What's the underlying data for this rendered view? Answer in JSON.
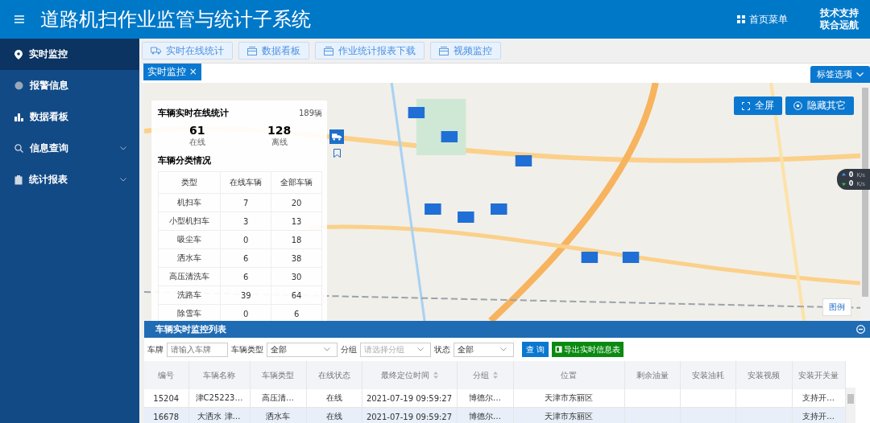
{
  "header": {
    "title": "道路机扫作业监管与统计子系统",
    "menu_label": "首页菜单",
    "support_line1": "技术支持",
    "support_line2": "联合远航"
  },
  "sidebar": {
    "items": [
      {
        "label": "实时监控",
        "kind": "link",
        "selected": true
      },
      {
        "label": "报警信息",
        "kind": "link",
        "selected": false
      },
      {
        "label": "数据看板",
        "kind": "link",
        "selected": false
      },
      {
        "label": "信息查询",
        "kind": "group",
        "selected": false
      },
      {
        "label": "统计报表",
        "kind": "group",
        "selected": false
      }
    ]
  },
  "toolbar": [
    {
      "label": "实时在线统计"
    },
    {
      "label": "数据看板"
    },
    {
      "label": "作业统计报表下载"
    },
    {
      "label": "视频监控"
    }
  ],
  "tags": [
    {
      "label": "实时监控",
      "close": "×",
      "selected": true
    }
  ],
  "tag_options": "标签选项",
  "map": {
    "fullscreen": "全屏",
    "hide_others": "隐藏其它",
    "legend": "图例"
  },
  "stats": {
    "title": "车辆实时在线统计",
    "total": "189辆",
    "online_count": "61",
    "online_label": "在线",
    "offline_count": "128",
    "offline_label": "离线",
    "category_title": "车辆分类情况",
    "columns": [
      "类型",
      "在线车辆",
      "全部车辆"
    ],
    "rows": [
      [
        "机扫车",
        "7",
        "20"
      ],
      [
        "小型机扫车",
        "3",
        "13"
      ],
      [
        "吸尘车",
        "0",
        "18"
      ],
      [
        "洒水车",
        "6",
        "38"
      ],
      [
        "高压清洗车",
        "6",
        "30"
      ],
      [
        "洗路车",
        "39",
        "64"
      ],
      [
        "除雪车",
        "0",
        "6"
      ]
    ]
  },
  "net_speed": {
    "up": "0",
    "up_unit": "K/s",
    "down": "0",
    "down_unit": "K/s"
  },
  "list": {
    "title": "车辆实时监控列表",
    "filters": {
      "plate_label": "车牌",
      "plate_placeholder": "请输入车牌",
      "type_label": "车辆类型",
      "type_value": "全部",
      "group_label": "分组",
      "group_placeholder": "请选择分组",
      "status_label": "状态",
      "status_value": "全部"
    },
    "query_button": "查 询",
    "export_button": "导出实时信息表",
    "columns": [
      {
        "label": "编号",
        "sortable": false
      },
      {
        "label": "车辆名称",
        "sortable": false
      },
      {
        "label": "车辆类型",
        "sortable": false
      },
      {
        "label": "在线状态",
        "sortable": false
      },
      {
        "label": "最终定位时间",
        "sortable": true
      },
      {
        "label": "分组",
        "sortable": true
      },
      {
        "label": "位置",
        "sortable": false
      },
      {
        "label": "剩余油量",
        "sortable": false
      },
      {
        "label": "安装油耗",
        "sortable": false
      },
      {
        "label": "安装视频",
        "sortable": false
      },
      {
        "label": "安装开关量",
        "sortable": false
      }
    ],
    "rows": [
      {
        "selected": false,
        "cells": [
          "15204",
          "津C25223…",
          "高压清…",
          "在线",
          "2021-07-19 09:59:27",
          "博德尔…",
          "天津市东丽区",
          "",
          "",
          "",
          "支持开…"
        ]
      },
      {
        "selected": true,
        "cells": [
          "16678",
          "大洒水 津…",
          "洒水车",
          "在线",
          "2021-07-19 09:59:27",
          "博德尔…",
          "天津市东丽区",
          "",
          "",
          "",
          "支持开…"
        ]
      }
    ]
  }
}
